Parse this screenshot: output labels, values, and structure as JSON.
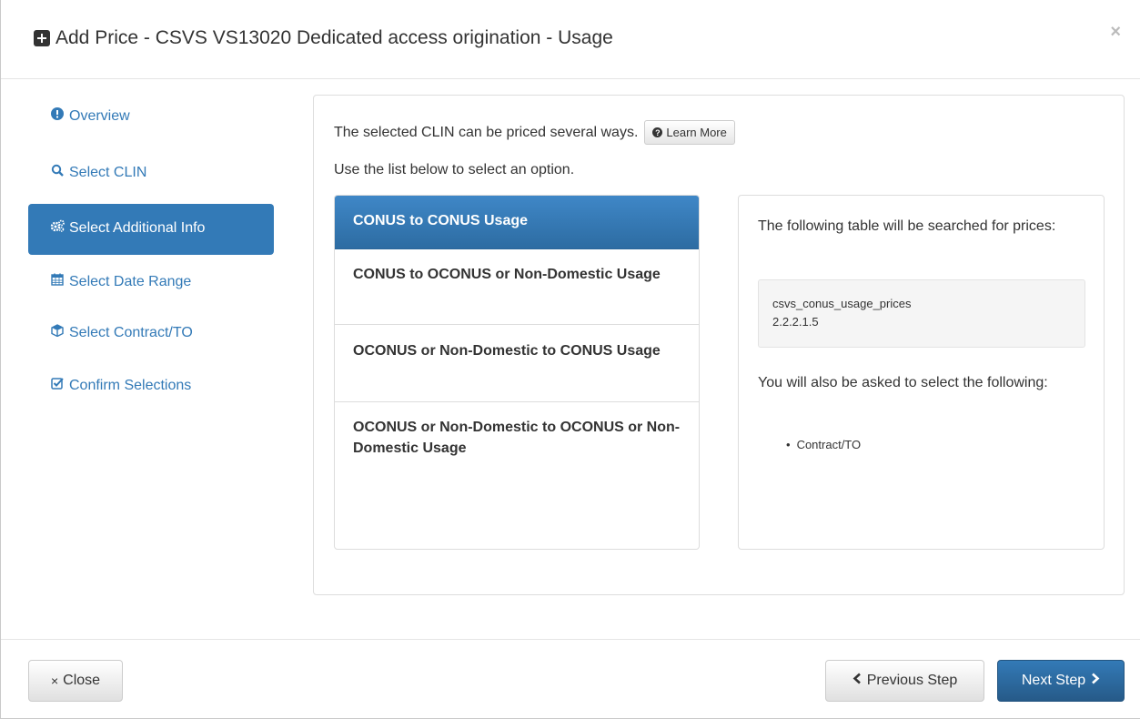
{
  "header": {
    "title": "Add Price - CSVS VS13020 Dedicated access origination - Usage",
    "close_symbol": "×"
  },
  "sidebar": {
    "items": [
      {
        "label": "Overview",
        "icon": "exclamation-circle-icon",
        "active": false
      },
      {
        "label": "Select CLIN",
        "icon": "search-icon",
        "active": false
      },
      {
        "label": "Select Additional Info",
        "icon": "cogs-icon",
        "active": true
      },
      {
        "label": "Select Date Range",
        "icon": "calendar-icon",
        "active": false
      },
      {
        "label": "Select Contract/TO",
        "icon": "cube-icon",
        "active": false
      },
      {
        "label": "Confirm Selections",
        "icon": "check-square-icon",
        "active": false
      }
    ]
  },
  "main": {
    "intro_line1": "The selected CLIN can be priced several ways.",
    "learn_more_label": "Learn More",
    "intro_line2": "Use the list below to select an option.",
    "options": [
      {
        "label": "CONUS to CONUS Usage",
        "active": true
      },
      {
        "label": "CONUS to OCONUS or Non-Domestic Usage",
        "active": false
      },
      {
        "label": "OCONUS or Non-Domestic to CONUS Usage",
        "active": false
      },
      {
        "label": "OCONUS or Non-Domestic to OCONUS or Non-Domestic Usage",
        "active": false
      }
    ],
    "info": {
      "text1": "The following table will be searched for prices:",
      "table_name": "csvs_conus_usage_prices",
      "table_version": "2.2.2.1.5",
      "text2": "You will also be asked to select the following:",
      "requirements": [
        "Contract/TO"
      ]
    }
  },
  "footer": {
    "close_label": "Close",
    "prev_label": "Previous Step",
    "next_label": "Next Step"
  },
  "colors": {
    "primary": "#337ab7",
    "text": "#333333",
    "border": "#dddddd"
  }
}
